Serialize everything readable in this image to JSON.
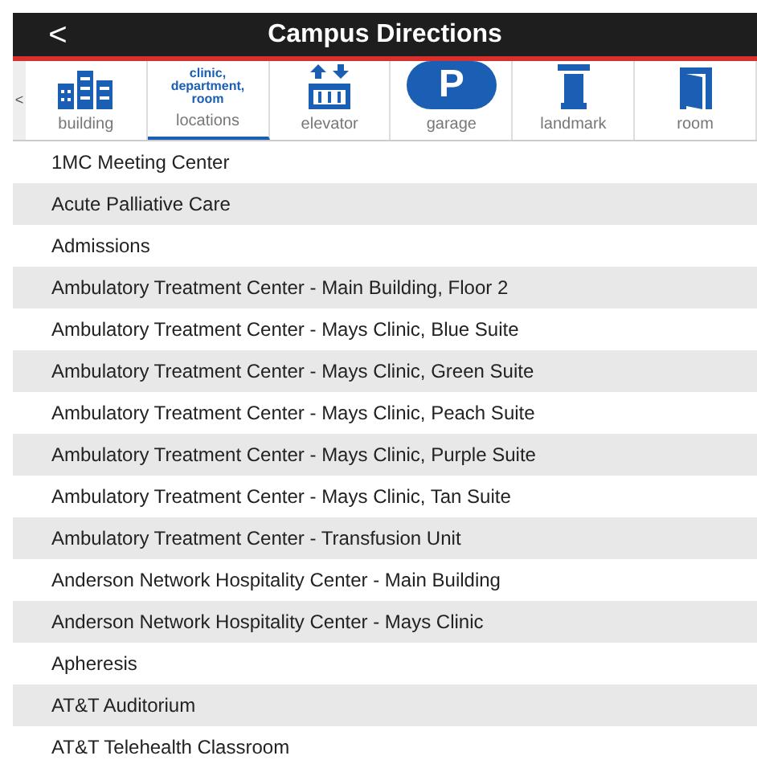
{
  "header": {
    "back": "<",
    "title": "Campus Directions"
  },
  "tabs_scroll": "<",
  "tabs": [
    {
      "kind": "building",
      "label": "building",
      "selected": false
    },
    {
      "kind": "text",
      "icon_text": "clinic, department, room",
      "label": "locations",
      "selected": true
    },
    {
      "kind": "elevator",
      "label": "elevator",
      "selected": false
    },
    {
      "kind": "parking",
      "icon_text": "P",
      "label": "garage",
      "selected": false
    },
    {
      "kind": "column",
      "label": "landmark",
      "selected": false
    },
    {
      "kind": "door",
      "label": "room",
      "selected": false
    }
  ],
  "locations": [
    "1MC Meeting Center",
    "Acute Palliative Care",
    "Admissions",
    "Ambulatory Treatment Center - Main Building, Floor 2",
    "Ambulatory Treatment Center - Mays Clinic, Blue Suite",
    "Ambulatory Treatment Center - Mays Clinic, Green Suite",
    "Ambulatory Treatment Center - Mays Clinic, Peach Suite",
    "Ambulatory Treatment Center - Mays Clinic, Purple Suite",
    "Ambulatory Treatment Center - Mays Clinic, Tan Suite",
    "Ambulatory Treatment Center - Transfusion Unit",
    "Anderson Network Hospitality Center - Main Building",
    "Anderson Network Hospitality Center - Mays Clinic",
    "Apheresis",
    "AT&T Auditorium",
    "AT&T Telehealth Classroom"
  ]
}
